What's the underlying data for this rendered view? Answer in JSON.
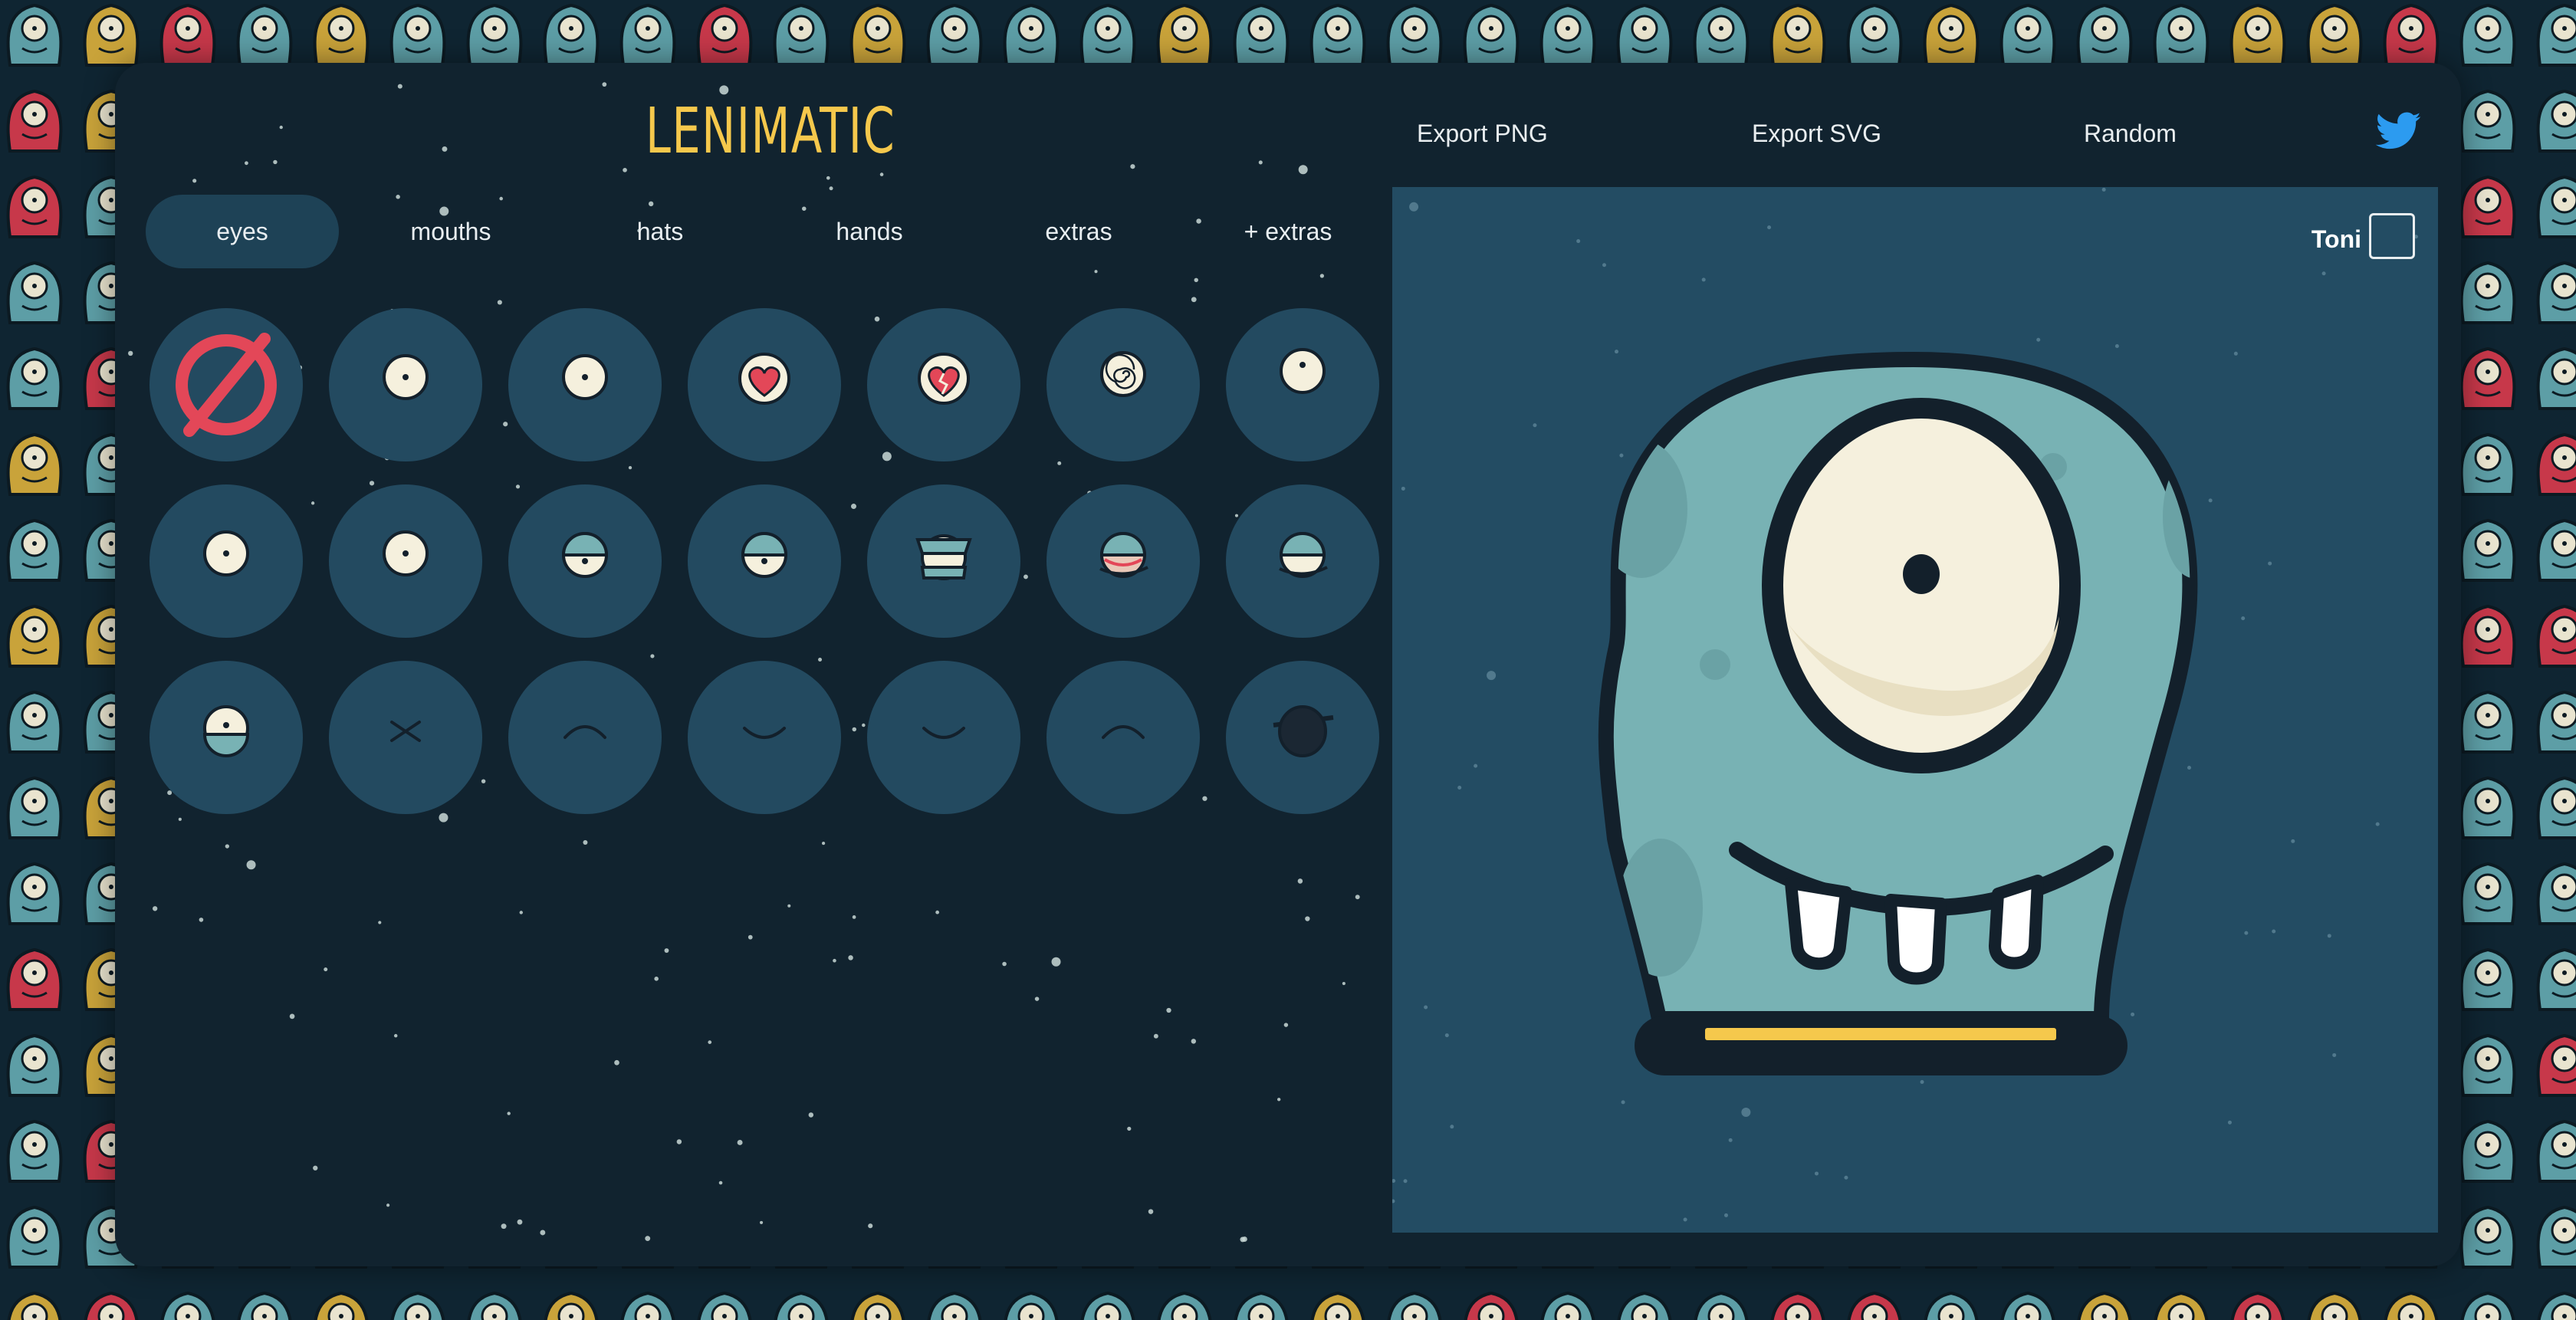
{
  "app": {
    "logo": "LENIMATIC"
  },
  "header": {
    "export_png": "Export PNG",
    "export_svg": "Export SVG",
    "random": "Random",
    "twitter_icon": "twitter-icon"
  },
  "tabs": [
    {
      "label": "eyes",
      "active": true
    },
    {
      "label": "mouths",
      "active": false
    },
    {
      "label": "hats",
      "active": false
    },
    {
      "label": "hands",
      "active": false
    },
    {
      "label": "extras",
      "active": false
    },
    {
      "label": "+ extras",
      "active": false
    }
  ],
  "eye_options": [
    "none-icon",
    "single-eye-icon",
    "single-eye-icon",
    "heart-eye-icon",
    "broken-heart-eye-icon",
    "spiral-eye-icon",
    "single-eye-up-icon",
    "single-eye-icon",
    "single-eye-icon",
    "half-lid-eye-icon",
    "half-lid-eye-icon",
    "angry-eye-icon",
    "sleepy-red-eye-icon",
    "sleepy-eye-icon",
    "lower-lid-eye-icon",
    "closed-x-eye-icon",
    "closed-arc-eye-icon",
    "closed-smile-eye-icon",
    "closed-smile-eye-icon",
    "closed-arc-eye-icon",
    "eyepatch-icon"
  ],
  "canvas": {
    "name_label": "Toni"
  },
  "colors": {
    "accent": "#f5c84c",
    "monster_body": "#78b2b4",
    "monster_outline": "#13202b",
    "eye_white": "#f5f0dd",
    "card_bg": "#11232f",
    "canvas_bg": "#234c63",
    "option_bg": "#234a60",
    "none_red": "#e34758"
  }
}
